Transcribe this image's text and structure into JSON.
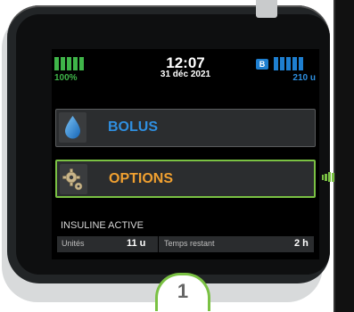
{
  "status": {
    "battery_percent": "100%",
    "battery_level": 1.0,
    "time": "12:07",
    "date": "31 déc 2021",
    "badge": "B",
    "insulin_amount": "210 u",
    "insulin_level": 1.0
  },
  "menu": {
    "bolus_label": "BOLUS",
    "options_label": "OPTIONS"
  },
  "active_insulin": {
    "title": "INSULINE ACTIVE",
    "units_label": "Unités",
    "units_value": "11 u",
    "time_label": "Temps restant",
    "time_value": "2 h"
  },
  "callout": {
    "number": "1"
  },
  "colors": {
    "battery": "#3fb549",
    "insulin": "#1e7fd0",
    "bolus_text": "#2f8fe0",
    "options_text": "#f0a030",
    "selection": "#7ac143"
  },
  "icons": {
    "bolus": "drop-icon",
    "options": "gear-icon",
    "side": "hand-pointer-icon"
  }
}
